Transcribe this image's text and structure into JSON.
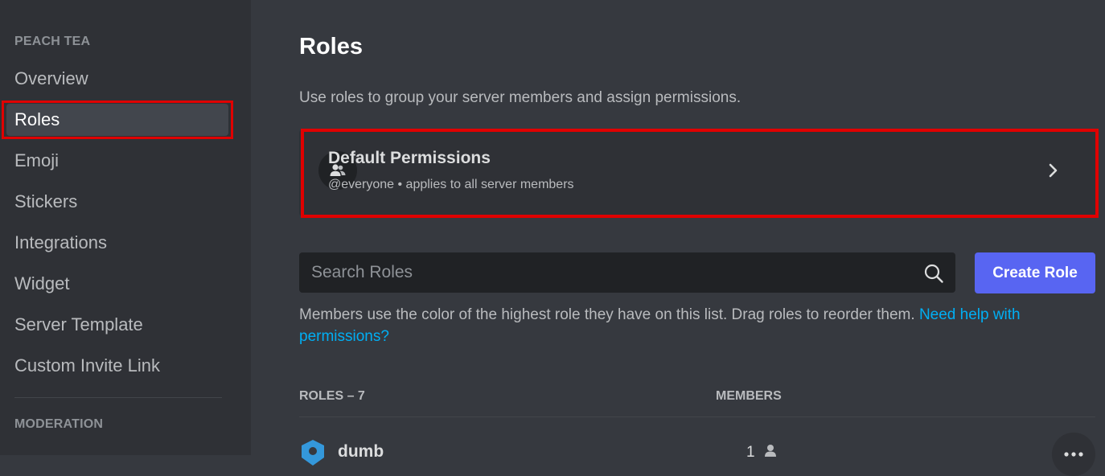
{
  "sidebar": {
    "section_title": "PEACH TEA",
    "items": [
      {
        "label": "Overview"
      },
      {
        "label": "Roles"
      },
      {
        "label": "Emoji"
      },
      {
        "label": "Stickers"
      },
      {
        "label": "Integrations"
      },
      {
        "label": "Widget"
      },
      {
        "label": "Server Template"
      },
      {
        "label": "Custom Invite Link"
      }
    ],
    "moderation_title": "MODERATION",
    "active_item": "Roles"
  },
  "main": {
    "title": "Roles",
    "description": "Use roles to group your server members and assign permissions.",
    "default_permissions": {
      "title": "Default Permissions",
      "subtitle": "@everyone • applies to all server members",
      "icon": "members-icon",
      "chevron_icon": "chevron-right-icon"
    },
    "search": {
      "placeholder": "Search Roles",
      "value": "",
      "icon": "search-icon"
    },
    "create_role_label": "Create Role",
    "help_text": "Members use the color of the highest role they have on this list. Drag roles to reorder them.",
    "help_link": "Need help with permissions?",
    "columns": {
      "roles": "ROLES – 7",
      "members": "MEMBERS"
    },
    "roles": [
      {
        "name": "dumb",
        "members": "1",
        "color": "#3498db",
        "icon": "shield-icon"
      }
    ]
  },
  "colors": {
    "sidebar_bg": "#2f3136",
    "main_bg": "#36393f",
    "accent": "#5865f2",
    "link": "#00aff4",
    "highlight": "#e00000"
  }
}
